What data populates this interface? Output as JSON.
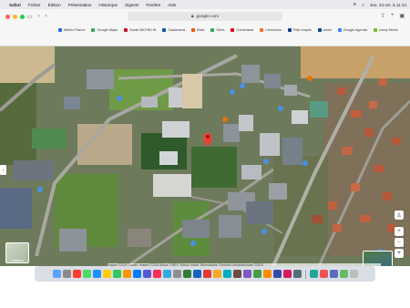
{
  "menubar": {
    "items": [
      "Safari",
      "Fichier",
      "Édition",
      "Présentation",
      "Historique",
      "Signets",
      "Fenêtre",
      "Aide"
    ],
    "clock": "Jeu. 24 oct. à 11:14"
  },
  "browser": {
    "url": "google.com",
    "bookmarks": [
      {
        "label": "Météo France",
        "color": "#1e73d6"
      },
      {
        "label": "Google Maps",
        "color": "#34a853"
      },
      {
        "label": "Guide MICHELIN",
        "color": "#c8102e"
      },
      {
        "label": "Castorama",
        "color": "#0057a8"
      },
      {
        "label": "Kiabi",
        "color": "#e95a0c"
      },
      {
        "label": "Gîtes",
        "color": "#2fa84f"
      },
      {
        "label": "Conforama",
        "color": "#e30613"
      },
      {
        "label": "Leboncoin",
        "color": "#f56b2a"
      },
      {
        "label": "Pôle emploi",
        "color": "#0e3a8a"
      },
      {
        "label": "ameli",
        "color": "#0c419a"
      },
      {
        "label": "Google Agenda",
        "color": "#4285f4"
      },
      {
        "label": "Leroy Merlin",
        "color": "#78be20"
      }
    ]
  },
  "map": {
    "attribution": "Images ©2024 Google, Images ©2024 Airbus, CNES / Airbus, Maxar Technologies, Données cartographiques ©2024",
    "layers_label": "Calques",
    "pin_color": "#ea4335"
  },
  "dock": {
    "icons": [
      "#5aa0ff",
      "#8a8a8a",
      "#ff3b30",
      "#4cd964",
      "#1e90ff",
      "#ffcc00",
      "#34c759",
      "#ff9500",
      "#007aff",
      "#5856d6",
      "#ff2d55",
      "#34aadc",
      "#8e8e93",
      "#2e7d32",
      "#1565c0",
      "#e53935",
      "#f9a825",
      "#00acc1",
      "#6d4c41",
      "#7e57c2",
      "#43a047",
      "#fb8c00",
      "#3949ab",
      "#d81b60",
      "#546e7a",
      "#26a69a",
      "#ef5350",
      "#5c6bc0",
      "#66bb6a",
      "#bdbdbd"
    ]
  }
}
